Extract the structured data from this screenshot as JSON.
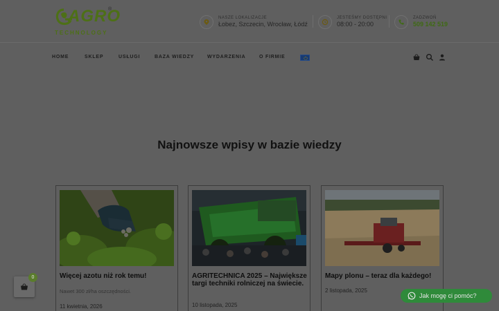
{
  "logo": {
    "main": "AGRO",
    "sub": "TECHNOLOGY",
    "reg": "®"
  },
  "header": {
    "locations": {
      "label": "NASZE LOKALIZACJE",
      "value": "Łobez, Szczecin, Wrocław, Łódź"
    },
    "hours": {
      "label": "JESTEŚMY DOSTĘPNI",
      "value": "08:00 - 20:00"
    },
    "phone": {
      "label": "ZADZWOŃ",
      "value": "509 142 519"
    }
  },
  "nav": {
    "items": [
      "HOME",
      "SKLEP",
      "USŁUGI",
      "BAZA WIEDZY",
      "WYDARZENIA",
      "O FIRMIE"
    ]
  },
  "section": {
    "heading_prefix": "Najnowsze wpisy w ",
    "heading_bold": "bazie wiedzy"
  },
  "posts": [
    {
      "title": "Więcej azotu niż rok temu!",
      "excerpt": "Nawet 300 zł/ha oszczędności.",
      "date": "11 kwietnia, 2026"
    },
    {
      "title": "AGRITECHNICA 2025 – Największe targi techniki rolniczej na świecie.",
      "excerpt": "",
      "date": "10 listopada, 2025"
    },
    {
      "title": "Mapy plonu – teraz dla każdego!",
      "excerpt": "",
      "date": "2 listopada, 2025"
    }
  ],
  "cart": {
    "count": "0"
  },
  "chat": {
    "label": "Jak mogę ci pomóc?"
  },
  "icons": [
    "map-pin-icon",
    "clock-icon",
    "phone-icon",
    "basket-icon",
    "search-icon",
    "user-icon",
    "eu-flag-icon",
    "whatsapp-icon"
  ],
  "colors": {
    "brand_green": "#4d7016",
    "chat_green": "#2f8a3a",
    "overlay": "#5f5f5f"
  }
}
